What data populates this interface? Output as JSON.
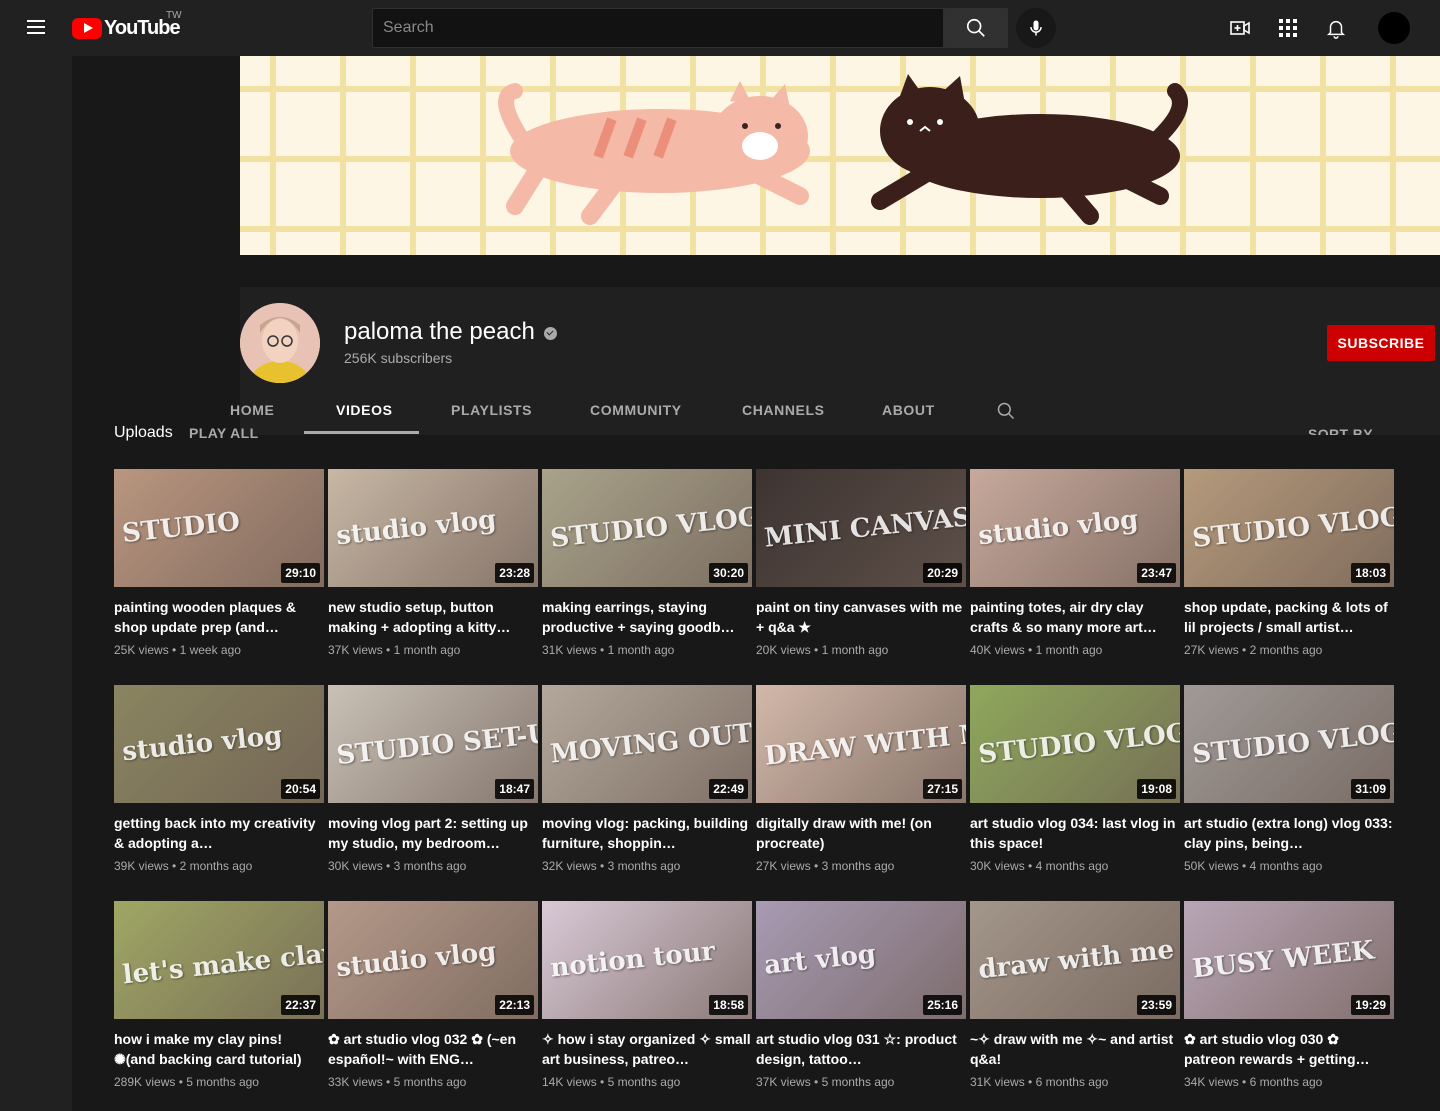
{
  "topbar": {
    "logo_text": "YouTube",
    "country": "TW",
    "search_placeholder": "Search",
    "icons": [
      "menu-icon",
      "search-icon",
      "mic-icon",
      "create-video-icon",
      "apps-icon",
      "notifications-icon"
    ]
  },
  "channel": {
    "name": "paloma the peach",
    "subscribers": "256K subscribers",
    "subscribe_label": "SUBSCRIBE",
    "accent": "#cc0000"
  },
  "tabs": [
    {
      "label": "HOME",
      "active": false
    },
    {
      "label": "VIDEOS",
      "active": true
    },
    {
      "label": "PLAYLISTS",
      "active": false
    },
    {
      "label": "COMMUNITY",
      "active": false
    },
    {
      "label": "CHANNELS",
      "active": false
    },
    {
      "label": "ABOUT",
      "active": false
    }
  ],
  "uploads": {
    "label": "Uploads",
    "play_all": "PLAY ALL",
    "sort_by": "SORT BY"
  },
  "videos": [
    {
      "title": "painting wooden plaques & shop update prep (and…",
      "views": "25K views",
      "age": "1 week ago",
      "duration": "29:10",
      "thumb_text": "STUDIO",
      "color": "#b9967f"
    },
    {
      "title": "new studio setup, button making + adopting a kitty…",
      "views": "37K views",
      "age": "1 month ago",
      "duration": "23:28",
      "thumb_text": "studio vlog",
      "color": "#c7b7a4"
    },
    {
      "title": "making earrings, staying productive + saying goodb…",
      "views": "31K views",
      "age": "1 month ago",
      "duration": "30:20",
      "thumb_text": "STUDIO VLOG",
      "color": "#a9a38a"
    },
    {
      "title": "paint on tiny canvases with me + q&a ★",
      "views": "20K views",
      "age": "1 month ago",
      "duration": "20:29",
      "thumb_text": "MINI CANVAS",
      "color": "#3d3431"
    },
    {
      "title": "painting totes, air dry clay crafts & so many more art…",
      "views": "40K views",
      "age": "1 month ago",
      "duration": "23:47",
      "thumb_text": "studio vlog",
      "color": "#c7a99c"
    },
    {
      "title": "shop update, packing & lots of lil projects / small artist…",
      "views": "27K views",
      "age": "2 months ago",
      "duration": "18:03",
      "thumb_text": "STUDIO VLOG",
      "color": "#b59a7b"
    },
    {
      "title": "getting back into my creativity & adopting a…",
      "views": "39K views",
      "age": "2 months ago",
      "duration": "20:54",
      "thumb_text": "studio vlog",
      "color": "#8a8560"
    },
    {
      "title": "moving vlog part 2: setting up my studio, my bedroom…",
      "views": "30K views",
      "age": "3 months ago",
      "duration": "18:47",
      "thumb_text": "STUDIO SET-UP",
      "color": "#c9c1b6"
    },
    {
      "title": "moving vlog: packing, building furniture, shoppin…",
      "views": "32K views",
      "age": "3 months ago",
      "duration": "22:49",
      "thumb_text": "MOVING OUT",
      "color": "#b3a89b"
    },
    {
      "title": "digitally draw with me! (on procreate)",
      "views": "27K views",
      "age": "3 months ago",
      "duration": "27:15",
      "thumb_text": "DRAW WITH ME",
      "color": "#d2b8a9"
    },
    {
      "title": "art studio vlog 034: last vlog in this space!",
      "views": "30K views",
      "age": "4 months ago",
      "duration": "19:08",
      "thumb_text": "STUDIO VLOG",
      "color": "#8fa85c"
    },
    {
      "title": "art studio (extra long) vlog 033: clay pins, being…",
      "views": "50K views",
      "age": "4 months ago",
      "duration": "31:09",
      "thumb_text": "STUDIO VLOG",
      "color": "#a09a96"
    },
    {
      "title": "how i make my clay pins! ✺(and backing card tutorial)",
      "views": "289K views",
      "age": "5 months ago",
      "duration": "22:37",
      "thumb_text": "let's make clay pins!",
      "color": "#9fa764"
    },
    {
      "title": "✿ art studio vlog 032 ✿ (~en español!~ with ENG…",
      "views": "33K views",
      "age": "5 months ago",
      "duration": "22:13",
      "thumb_text": "studio vlog",
      "color": "#b49989"
    },
    {
      "title": "✧ how i stay organized ✧ small art business, patreo…",
      "views": "14K views",
      "age": "5 months ago",
      "duration": "18:58",
      "thumb_text": "notion tour",
      "color": "#d9c9d6"
    },
    {
      "title": "art studio vlog 031 ☆: product design, tattoo…",
      "views": "37K views",
      "age": "5 months ago",
      "duration": "25:16",
      "thumb_text": "art vlog",
      "color": "#a89bb3"
    },
    {
      "title": "~✧ draw with me ✧~ and artist q&a!",
      "views": "31K views",
      "age": "6 months ago",
      "duration": "23:59",
      "thumb_text": "draw with me",
      "color": "#a3968a"
    },
    {
      "title": "✿ art studio vlog 030 ✿ patreon rewards + getting…",
      "views": "34K views",
      "age": "6 months ago",
      "duration": "19:29",
      "thumb_text": "BUSY WEEK",
      "color": "#b9a6b6"
    }
  ]
}
